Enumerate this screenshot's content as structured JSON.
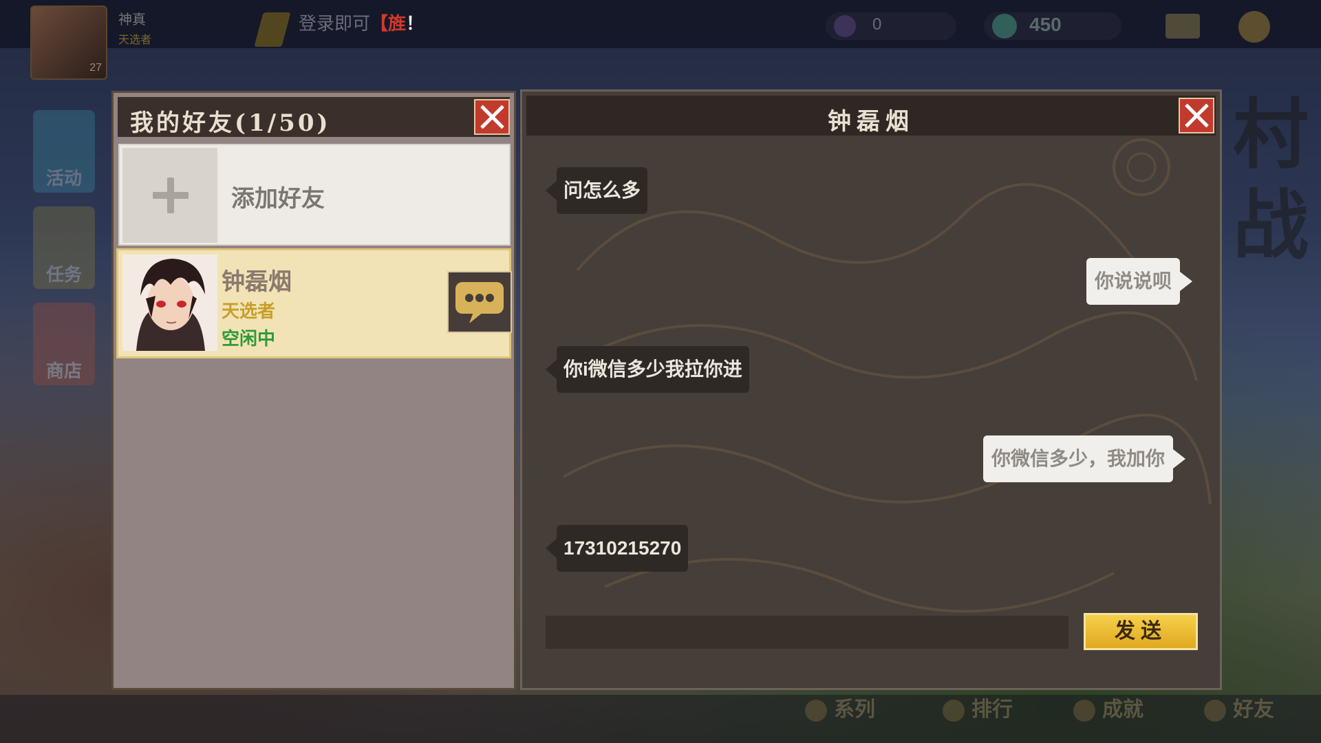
{
  "hud": {
    "player_name": "神真",
    "player_title": "天选者",
    "player_level": "27",
    "notice_text": "登录即可",
    "notice_highlight": "【旌",
    "notice_end": "！",
    "resource1_value": "0",
    "resource2_value": "450"
  },
  "side_menu": [
    "活动",
    "任务",
    "商店"
  ],
  "calligraphy": "村战",
  "bottom_nav": [
    "系列",
    "排行",
    "成就",
    "好友"
  ],
  "friends_panel": {
    "title": "我的好友(1/50)",
    "add_friend_label": "添加好友",
    "friends": [
      {
        "name": "钟磊烟",
        "role": "天选者",
        "status": "空闲中"
      }
    ]
  },
  "chat_panel": {
    "title": "钟磊烟",
    "messages": [
      {
        "side": "left",
        "text": "问怎么多"
      },
      {
        "side": "right",
        "text": "你说说呗"
      },
      {
        "side": "left",
        "text": "你i微信多少我拉你进"
      },
      {
        "side": "right",
        "text": "你微信多少，我加你"
      },
      {
        "side": "left",
        "text": "17310215270"
      }
    ],
    "input_placeholder": "",
    "send_label": "发送"
  },
  "colors": {
    "close_red": "#c23a2e",
    "send_gold": "#f6d04a",
    "status_green": "#2e9a3a",
    "role_gold": "#c69e2a"
  }
}
